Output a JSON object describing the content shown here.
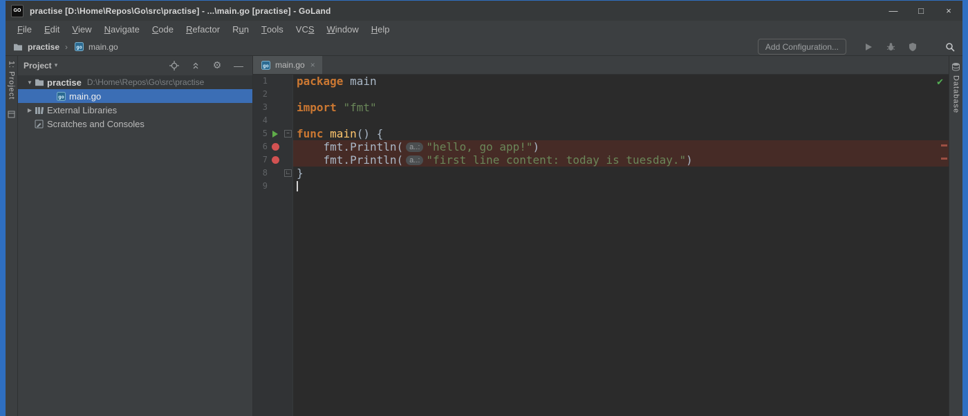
{
  "colors": {
    "window_border": "#2f6fc1",
    "panel_bg": "#3c3f41",
    "editor_bg": "#2b2b2b",
    "gutter_bg": "#313335",
    "selection_blue": "#3b6eb5",
    "breakpoint_red": "#d25252",
    "breakpoint_line_bg": "#462b26",
    "run_green": "#5fad49",
    "keyword_orange": "#cc7832",
    "string_green": "#6a8759",
    "function_yellow": "#ffc66d"
  },
  "window": {
    "logo": "GO",
    "title": "practise [D:\\Home\\Repos\\Go\\src\\practise] - ...\\main.go [practise] - GoLand"
  },
  "icons": {
    "minimize": "—",
    "maximize": "□",
    "close": "×",
    "tab_close": "×",
    "breadcrumb_separator": "›",
    "project_dropdown": "▾",
    "gear": "⚙",
    "hide": "—",
    "check": "✔"
  },
  "menu": {
    "items": [
      {
        "label": "File",
        "mnemonic": 0
      },
      {
        "label": "Edit",
        "mnemonic": 0
      },
      {
        "label": "View",
        "mnemonic": 0
      },
      {
        "label": "Navigate",
        "mnemonic": 0
      },
      {
        "label": "Code",
        "mnemonic": 0
      },
      {
        "label": "Refactor",
        "mnemonic": 0
      },
      {
        "label": "Run",
        "mnemonic": 1
      },
      {
        "label": "Tools",
        "mnemonic": 0
      },
      {
        "label": "VCS",
        "mnemonic": 2
      },
      {
        "label": "Window",
        "mnemonic": 0
      },
      {
        "label": "Help",
        "mnemonic": 0
      }
    ]
  },
  "toolbar": {
    "breadcrumb": {
      "project": "practise",
      "file": "main.go"
    },
    "add_configuration": "Add Configuration..."
  },
  "stripes": {
    "left": "1: Project",
    "right": "Database"
  },
  "project_panel": {
    "title": "Project",
    "tree": [
      {
        "level": 0,
        "arrow": "▼",
        "icon": "folder-icon",
        "label": "practise",
        "bold": true,
        "path": "D:\\Home\\Repos\\Go\\src\\practise",
        "state": "context"
      },
      {
        "level": 1,
        "icon": "go-file-icon",
        "label": "main.go",
        "state": "selected"
      },
      {
        "level": 0,
        "arrow": "▶",
        "icon": "library-icon",
        "label": "External Libraries"
      },
      {
        "level": 0,
        "icon": "scratches-icon",
        "label": "Scratches and Consoles"
      }
    ]
  },
  "editor": {
    "tab": "main.go",
    "lines": [
      {
        "num": "1",
        "tokens": [
          [
            "kw",
            "package"
          ],
          [
            "pl",
            " main"
          ]
        ]
      },
      {
        "num": "2",
        "tokens": []
      },
      {
        "num": "3",
        "tokens": [
          [
            "kw",
            "import"
          ],
          [
            "pl",
            " "
          ],
          [
            "str",
            "\"fmt\""
          ]
        ]
      },
      {
        "num": "4",
        "tokens": []
      },
      {
        "num": "5",
        "gutter": "run",
        "fold": "−",
        "tokens": [
          [
            "kw",
            "func"
          ],
          [
            "pl",
            " "
          ],
          [
            "fn",
            "main"
          ],
          [
            "pl",
            "() {"
          ]
        ]
      },
      {
        "num": "6",
        "gutter": "breakpoint",
        "highlight": true,
        "tokens": [
          [
            "pl",
            "    fmt.Println("
          ],
          [
            "hint",
            "a..:"
          ],
          [
            "str",
            "\"hello, go app!\""
          ],
          [
            "pl",
            ")"
          ]
        ]
      },
      {
        "num": "7",
        "gutter": "breakpoint",
        "highlight": true,
        "tokens": [
          [
            "pl",
            "    fmt.Println("
          ],
          [
            "hint",
            "a..:"
          ],
          [
            "str",
            "\"first line content: today is tuesday.\""
          ],
          [
            "pl",
            ")"
          ]
        ]
      },
      {
        "num": "8",
        "fold": "∟",
        "tokens": [
          [
            "pl",
            "}"
          ]
        ]
      },
      {
        "num": "9",
        "caret": true,
        "tokens": []
      }
    ]
  }
}
